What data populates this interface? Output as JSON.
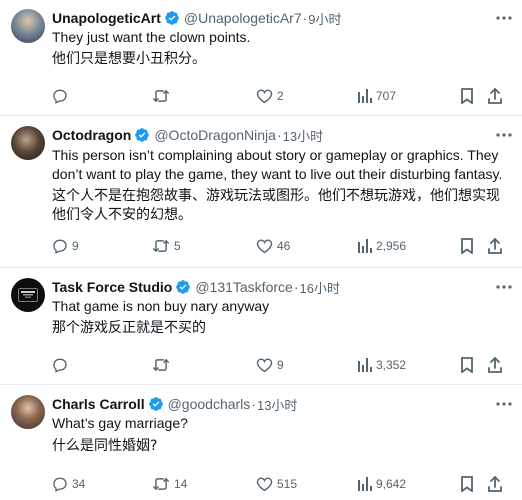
{
  "tweets": [
    {
      "name": "UnapologeticArt",
      "handle": "@UnapologeticAr7",
      "time": "9小时",
      "text": "They just want the clown points.",
      "translation": "他们只是想要小丑积分。",
      "replies": "",
      "retweets": "",
      "likes": "2",
      "views": "707"
    },
    {
      "name": "Octodragon",
      "handle": "@OctoDragonNinja",
      "time": "13小时",
      "text": "This person isn’t complaining about story or gameplay or graphics. They don’t want to play the game, they want to live out their disturbing fantasy.",
      "translation": "这个人不是在抱怨故事、游戏玩法或图形。他们不想玩游戏，他们想实现他们令人不安的幻想。",
      "replies": "9",
      "retweets": "5",
      "likes": "46",
      "views": "2,956"
    },
    {
      "name": "Task Force Studio",
      "handle": "@131Taskforce",
      "time": "16小时",
      "text": "That game is non buy nary anyway",
      "translation": "那个游戏反正就是不买的",
      "replies": "",
      "retweets": "",
      "likes": "9",
      "views": "3,352"
    },
    {
      "name": "Charls Carroll",
      "handle": "@goodcharls",
      "time": "13小时",
      "text": "What’s gay marriage?",
      "translation": "什么是同性婚姻?",
      "replies": "34",
      "retweets": "14",
      "likes": "515",
      "views": "9,642"
    }
  ],
  "separator": "·",
  "icons": {
    "verified": "verified-badge-icon",
    "more": "more-dots-icon",
    "reply": "reply-bubble-icon",
    "retweet": "retweet-icon",
    "like": "heart-icon",
    "views": "views-bars-icon",
    "bookmark": "bookmark-icon",
    "share": "share-icon"
  },
  "colors": {
    "text": "#0f1419",
    "secondary": "#536471",
    "verified": "#1d9bf0",
    "divider": "#e6ecf0"
  }
}
